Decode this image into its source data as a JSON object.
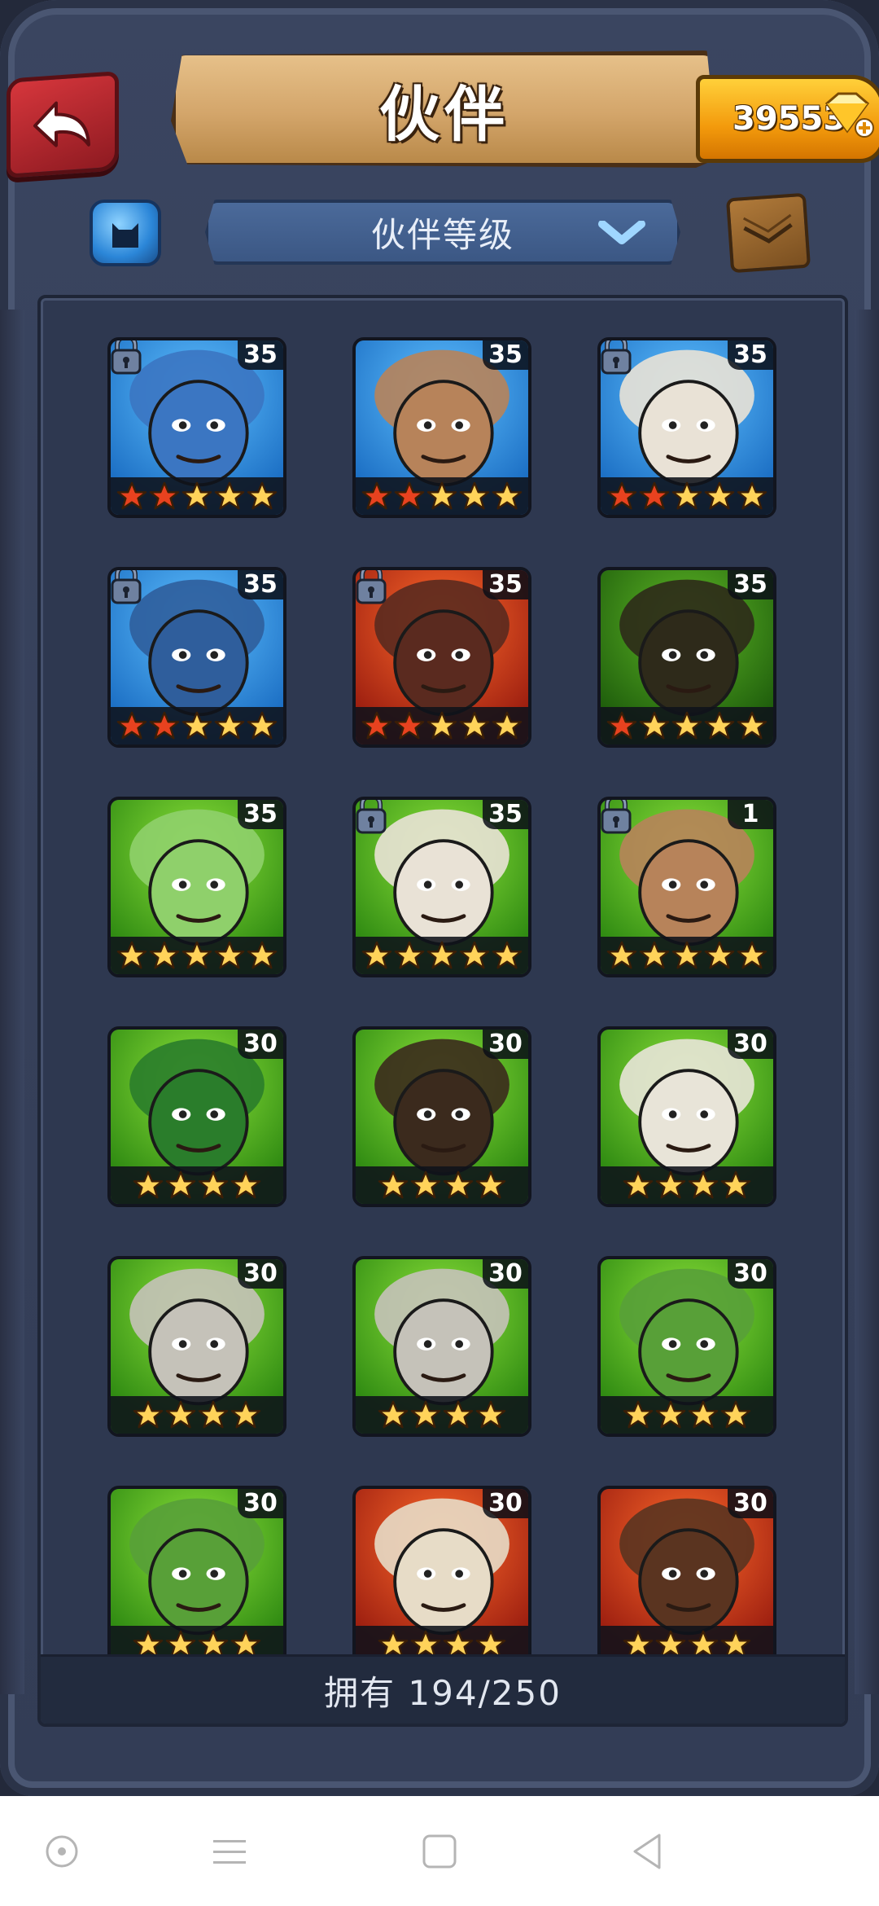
{
  "header": {
    "title": "伙伴",
    "gems": "39553"
  },
  "filter": {
    "label": "伙伴等级"
  },
  "footer": {
    "owned": "拥有 194/250"
  },
  "colors": {
    "star_red": "#e8421f",
    "star_gold": "#ffd35a",
    "bg_blue": "#2e8ad8",
    "bg_green": "#4fb21e",
    "bg_red": "#c8351b",
    "bg_darkgreen": "#3f8f19"
  },
  "heroes": [
    {
      "level": "35",
      "stars": 5,
      "red_stars": 2,
      "locked": true,
      "bg": "blue",
      "portrait": "blue-elephant-beast"
    },
    {
      "level": "35",
      "stars": 5,
      "red_stars": 2,
      "locked": false,
      "bg": "blue",
      "portrait": "mohawk-brute"
    },
    {
      "level": "35",
      "stars": 5,
      "red_stars": 2,
      "locked": true,
      "bg": "blue",
      "portrait": "white-haired-woman"
    },
    {
      "level": "35",
      "stars": 5,
      "red_stars": 2,
      "locked": true,
      "bg": "blue",
      "portrait": "blue-haired-warrior"
    },
    {
      "level": "35",
      "stars": 5,
      "red_stars": 2,
      "locked": true,
      "bg": "red",
      "portrait": "afro-woman-red"
    },
    {
      "level": "35",
      "stars": 5,
      "red_stars": 1,
      "locked": false,
      "bg": "darkgreen",
      "portrait": "afro-woman-green"
    },
    {
      "level": "35",
      "stars": 5,
      "red_stars": 0,
      "locked": false,
      "bg": "green",
      "portrait": "shark-beast"
    },
    {
      "level": "35",
      "stars": 5,
      "red_stars": 0,
      "locked": true,
      "bg": "green",
      "portrait": "white-haired-woman"
    },
    {
      "level": "1",
      "stars": 5,
      "red_stars": 0,
      "locked": true,
      "bg": "green",
      "portrait": "mohawk-brute"
    },
    {
      "level": "30",
      "stars": 4,
      "red_stars": 0,
      "locked": false,
      "bg": "green",
      "portrait": "dragon-beast"
    },
    {
      "level": "30",
      "stars": 4,
      "red_stars": 0,
      "locked": false,
      "bg": "green",
      "portrait": "ponytail-woman"
    },
    {
      "level": "30",
      "stars": 4,
      "red_stars": 0,
      "locked": false,
      "bg": "green",
      "portrait": "armored-dino"
    },
    {
      "level": "30",
      "stars": 4,
      "red_stars": 0,
      "locked": false,
      "bg": "green",
      "portrait": "wolf-beast"
    },
    {
      "level": "30",
      "stars": 4,
      "red_stars": 0,
      "locked": false,
      "bg": "green",
      "portrait": "wolf-beast"
    },
    {
      "level": "30",
      "stars": 4,
      "red_stars": 0,
      "locked": false,
      "bg": "green",
      "portrait": "lizard-beast"
    },
    {
      "level": "30",
      "stars": 4,
      "red_stars": 0,
      "locked": false,
      "bg": "green",
      "portrait": "lizard-beast"
    },
    {
      "level": "30",
      "stars": 4,
      "red_stars": 0,
      "locked": false,
      "bg": "red",
      "portrait": "skull-shaman"
    },
    {
      "level": "30",
      "stars": 4,
      "red_stars": 0,
      "locked": false,
      "bg": "red",
      "portrait": "long-haired-man"
    }
  ]
}
